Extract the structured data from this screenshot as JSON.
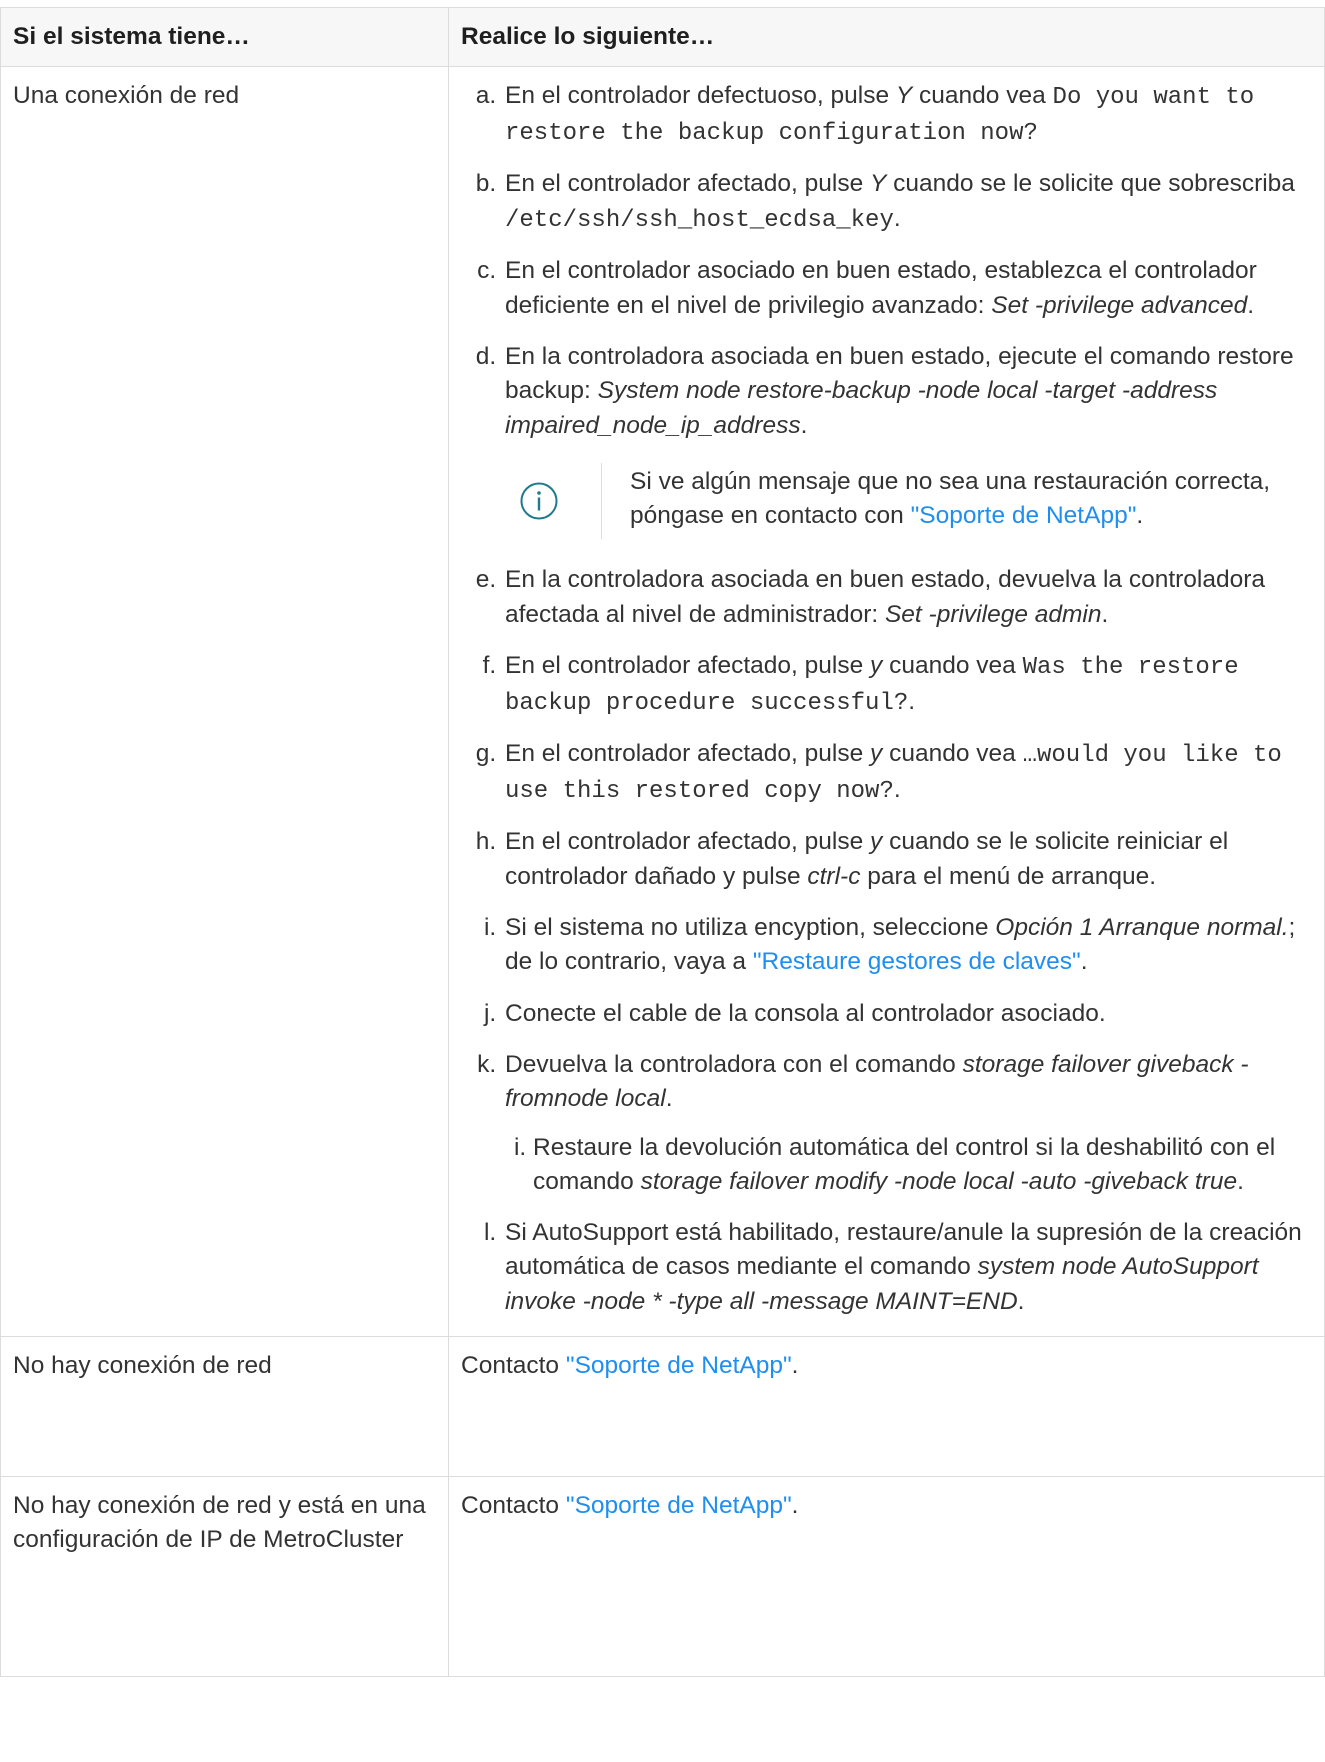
{
  "table": {
    "header": {
      "col1": "Si el sistema tiene…",
      "col2": "Realice lo siguiente…"
    },
    "row1": {
      "condition": "Una conexión de red",
      "steps": {
        "a": {
          "t1": "En el controlador defectuoso, pulse ",
          "em": "Y",
          "t2": " cuando vea ",
          "code": "Do you want to restore the backup configuration now?"
        },
        "b": {
          "t1": "En el controlador afectado, pulse ",
          "em": "Y",
          "t2": " cuando se le solicite que sobrescriba ",
          "code": "/etc/ssh/ssh_host_ecdsa_key",
          "t3": "."
        },
        "c": {
          "t1": "En el controlador asociado en buen estado, establezca el controlador deficiente en el nivel de privilegio avanzado: ",
          "em": "Set -privilege advanced",
          "t2": "."
        },
        "d": {
          "t1": "En la controladora asociada en buen estado, ejecute el comando restore backup: ",
          "em": "System node restore-backup -node local -target -address impaired_node_ip_address",
          "t2": "."
        },
        "note": {
          "t1": "Si ve algún mensaje que no sea una restauración correcta, póngase en contacto con ",
          "link": "\"Soporte de NetApp\"",
          "t2": "."
        },
        "e": {
          "t1": "En la controladora asociada en buen estado, devuelva la controladora afectada al nivel de administrador: ",
          "em": "Set -privilege admin",
          "t2": "."
        },
        "f": {
          "t1": "En el controlador afectado, pulse ",
          "em": "y",
          "t2": " cuando vea ",
          "code": "Was the restore backup procedure successful?",
          "t3": "."
        },
        "g": {
          "t1": "En el controlador afectado, pulse ",
          "em": "y",
          "t2": " cuando vea ",
          "code": "…would you like to use this restored copy now?",
          "t3": "."
        },
        "h": {
          "t1": "En el controlador afectado, pulse ",
          "em": "y",
          "t2": " cuando se le solicite reiniciar el controlador dañado y pulse ",
          "em2": "ctrl-c",
          "t3": " para el menú de arranque."
        },
        "i": {
          "t1": "Si el sistema no utiliza encyption, seleccione ",
          "em": "Opción 1 Arranque normal.",
          "t2": "; de lo contrario, vaya a ",
          "link": "\"Restaure gestores de claves\"",
          "t3": "."
        },
        "j": {
          "t1": "Conecte el cable de la consola al controlador asociado."
        },
        "k": {
          "t1": "Devuelva la controladora con el comando ",
          "em": "storage failover giveback -fromnode local",
          "t2": ".",
          "sub": {
            "t1": "Restaure la devolución automática del control si la deshabilitó con el comando ",
            "em": "storage failover modify -node local -auto -giveback true",
            "t2": "."
          }
        },
        "l": {
          "t1": "Si AutoSupport está habilitado, restaure/anule la supresión de la creación automática de casos mediante el comando ",
          "em": "system node AutoSupport invoke -node * -type all -message MAINT=END",
          "t2": "."
        }
      }
    },
    "row2": {
      "condition": "No hay conexión de red",
      "t1": "Contacto ",
      "link": "\"Soporte de NetApp\"",
      "t2": "."
    },
    "row3": {
      "condition": "No hay conexión de red y está en una configuración de IP de MetroCluster",
      "t1": "Contacto ",
      "link": "\"Soporte de NetApp\"",
      "t2": "."
    }
  },
  "colors": {
    "link": "#1f8ef1",
    "border": "#dcdcdc",
    "header_bg": "#f7f7f7"
  }
}
